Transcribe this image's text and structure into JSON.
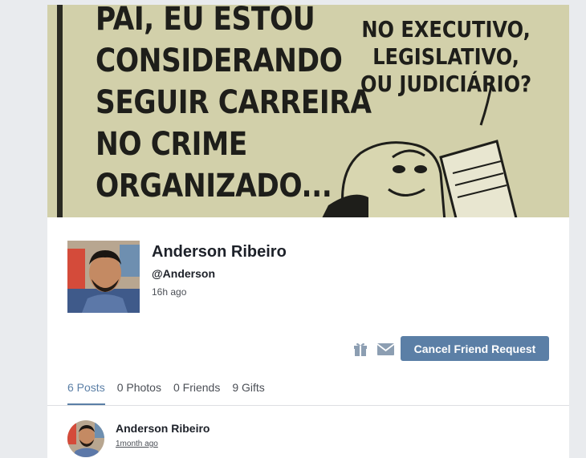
{
  "cover": {
    "text_left": "PAI, EU ESTOU\nCONSIDERANDO\nSEGUIR CARREIRA\nNO CRIME\nORGANIZADO...",
    "text_right": "NO EXECUTIVO,\nLEGISLATIVO,\nOU JUDICIÁRIO?"
  },
  "profile": {
    "name": "Anderson Ribeiro",
    "handle": "@Anderson",
    "time_ago": "16h ago"
  },
  "actions": {
    "gift_icon": "gift-icon",
    "mail_icon": "mail-icon",
    "friend_button_label": "Cancel Friend Request",
    "accent_color": "#5b7fa6"
  },
  "tabs": [
    {
      "label": "6 Posts",
      "active": true
    },
    {
      "label": "0 Photos",
      "active": false
    },
    {
      "label": "0 Friends",
      "active": false
    },
    {
      "label": "9 Gifts",
      "active": false
    }
  ],
  "post": {
    "author": "Anderson Ribeiro",
    "time": "1month ago"
  }
}
